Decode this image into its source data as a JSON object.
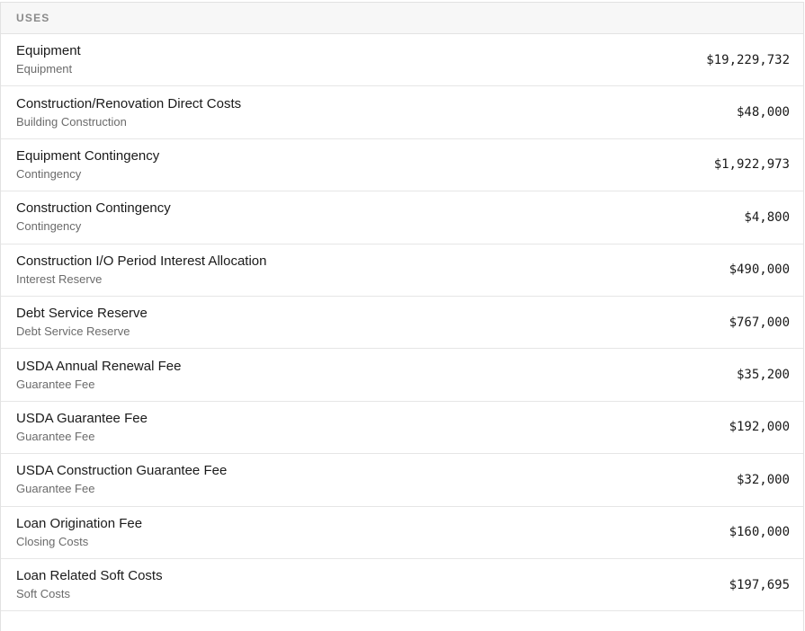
{
  "section": {
    "title": "USES"
  },
  "rows": [
    {
      "name": "Equipment",
      "category": "Equipment",
      "amount": "$19,229,732"
    },
    {
      "name": "Construction/Renovation Direct Costs",
      "category": "Building Construction",
      "amount": "$48,000"
    },
    {
      "name": "Equipment Contingency",
      "category": "Contingency",
      "amount": "$1,922,973"
    },
    {
      "name": "Construction Contingency",
      "category": "Contingency",
      "amount": "$4,800"
    },
    {
      "name": "Construction I/O Period Interest Allocation",
      "category": "Interest Reserve",
      "amount": "$490,000"
    },
    {
      "name": "Debt Service Reserve",
      "category": "Debt Service Reserve",
      "amount": "$767,000"
    },
    {
      "name": "USDA Annual Renewal Fee",
      "category": "Guarantee Fee",
      "amount": "$35,200"
    },
    {
      "name": "USDA Guarantee Fee",
      "category": "Guarantee Fee",
      "amount": "$192,000"
    },
    {
      "name": "USDA Construction Guarantee Fee",
      "category": "Guarantee Fee",
      "amount": "$32,000"
    },
    {
      "name": "Loan Origination Fee",
      "category": "Closing Costs",
      "amount": "$160,000"
    },
    {
      "name": "Loan Related Soft Costs",
      "category": "Soft Costs",
      "amount": "$197,695"
    }
  ]
}
